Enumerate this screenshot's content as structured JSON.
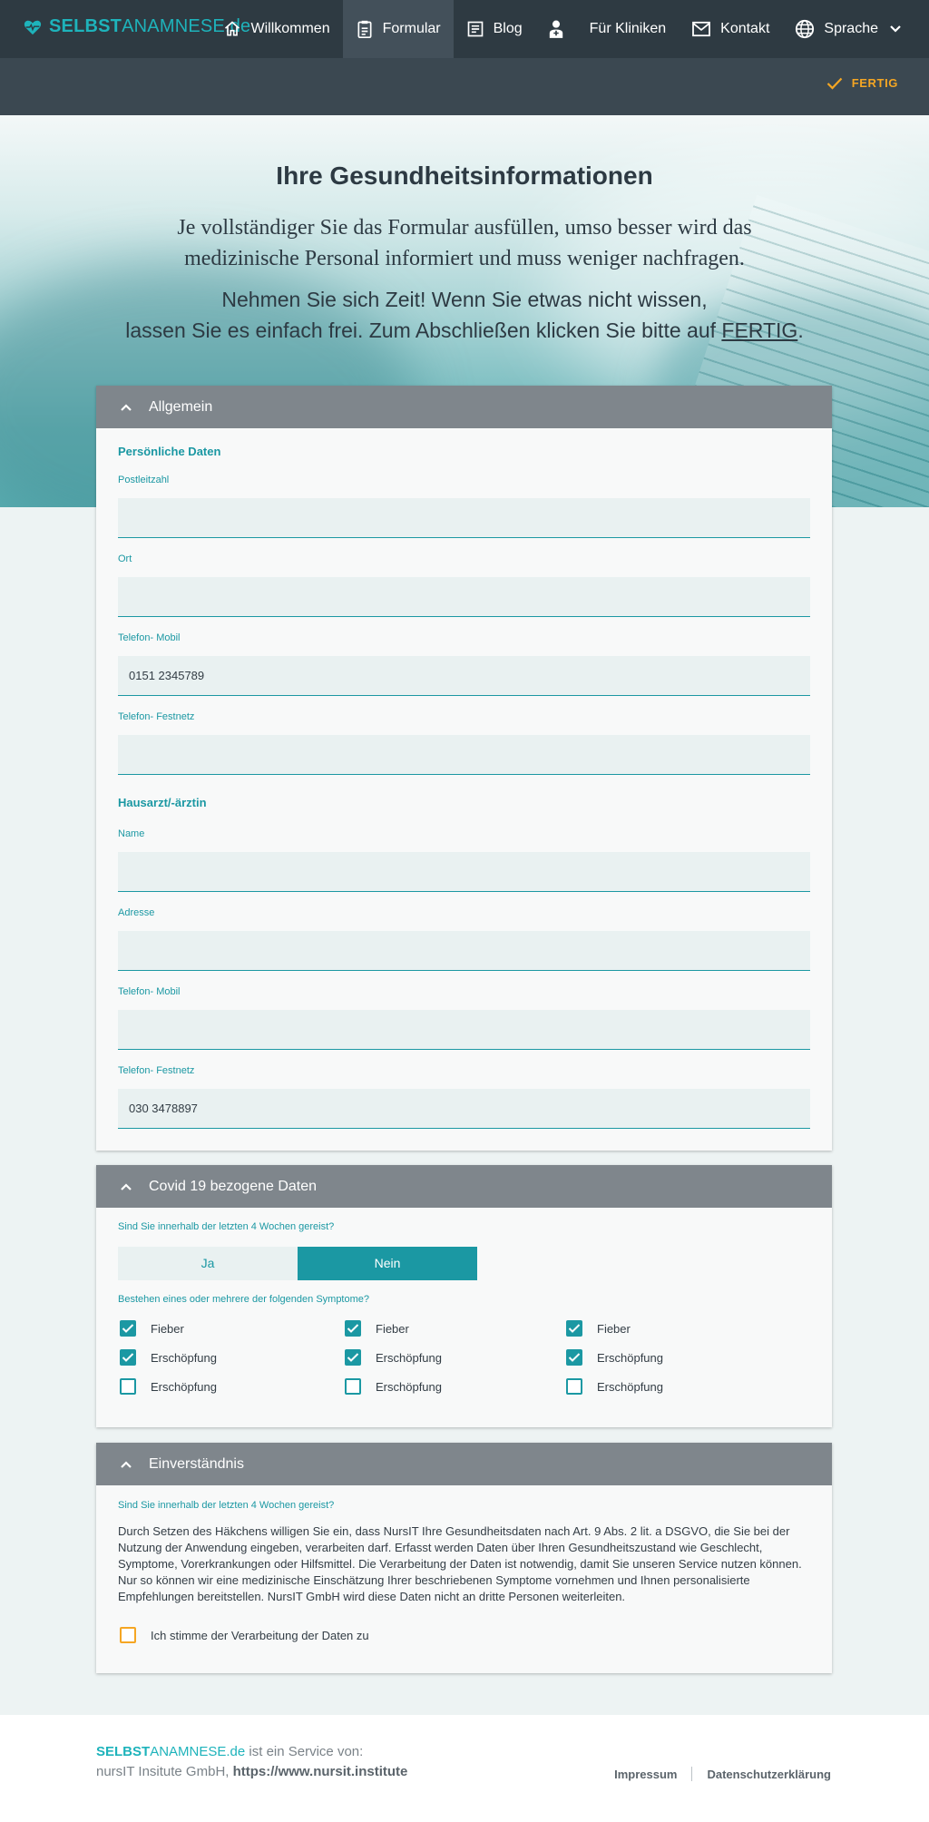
{
  "nav": {
    "logo": {
      "part1": "SELBST",
      "part2": "ANAMNESE",
      "part3": ".de"
    },
    "items": [
      {
        "label": "Willkommen",
        "icon": "home-icon"
      },
      {
        "label": "Formular",
        "icon": "clipboard-icon"
      },
      {
        "label": "Blog",
        "icon": "article-icon"
      },
      {
        "label": "Für Kliniken",
        "icon": "doctor-icon"
      },
      {
        "label": "Kontakt",
        "icon": "mail-icon"
      },
      {
        "label": "Sprache",
        "icon": "globe-icon"
      }
    ],
    "fertig_label": "FERTIG"
  },
  "hero": {
    "title": "Ihre Gesundheitsinformationen",
    "lead": "Je vollständiger Sie das Formular ausfüllen, umso besser wird das medizinische Personal informiert und muss weniger nachfragen.",
    "sub_line1": "Nehmen Sie sich Zeit! Wenn Sie etwas nicht wissen,",
    "sub_line2": "lassen Sie es einfach frei. Zum Abschließen klicken Sie bitte auf",
    "sub_link": "FERTIG",
    "sub_end": "."
  },
  "allgemein": {
    "heading": "Allgemein",
    "personal_title": "Persönliche Daten",
    "plz_label": "Postleitzahl",
    "plz_value": "",
    "ort_label": "Ort",
    "ort_value": "",
    "mobil_label": "Telefon- Mobil",
    "mobil_value": "0151 2345789",
    "fest_label": "Telefon- Festnetz",
    "fest_value": "",
    "doctor_title": "Hausarzt/-ärztin",
    "d_name_label": "Name",
    "d_name_value": "",
    "d_addr_label": "Adresse",
    "d_addr_value": "",
    "d_mobil_label": "Telefon- Mobil",
    "d_mobil_value": "",
    "d_fest_label": "Telefon- Festnetz",
    "d_fest_value": "030 3478897"
  },
  "covid": {
    "heading": "Covid 19 bezogene Daten",
    "q1": "Sind Sie innerhalb der letzten 4 Wochen gereist?",
    "yes": "Ja",
    "no": "Nein",
    "selected": "Nein",
    "q2": "Bestehen eines oder mehrere der folgenden Symptome?",
    "symptoms": [
      [
        {
          "label": "Fieber",
          "checked": true
        },
        {
          "label": "Fieber",
          "checked": true
        },
        {
          "label": "Fieber",
          "checked": true
        }
      ],
      [
        {
          "label": "Erschöpfung",
          "checked": true
        },
        {
          "label": "Erschöpfung",
          "checked": true
        },
        {
          "label": "Erschöpfung",
          "checked": true
        }
      ],
      [
        {
          "label": "Erschöpfung",
          "checked": false
        },
        {
          "label": "Erschöpfung",
          "checked": false
        },
        {
          "label": "Erschöpfung",
          "checked": false
        }
      ]
    ]
  },
  "consent": {
    "heading": "Einverständnis",
    "q": "Sind Sie innerhalb der letzten 4 Wochen gereist?",
    "text": "Durch Setzen des Häkchens willigen Sie ein, dass NursIT Ihre Gesundheitsdaten nach Art. 9 Abs. 2 lit. a DSGVO, die Sie bei der Nutzung der Anwendung eingeben, verarbeiten darf. Erfasst werden Daten über Ihren Gesundheitszustand wie Geschlecht, Symptome, Vorerkrankungen oder Hilfsmittel. Die Verarbeitung der Daten ist notwendig, damit Sie unseren Service nutzen können. Nur so können wir eine medizinische Einschätzung Ihrer beschriebenen Symptome vornehmen und Ihnen personalisierte Empfehlungen bereitstellen. NursIT GmbH wird diese Daten nicht an dritte Personen weiterleiten.",
    "checkbox_label": "Ich stimme der Verarbeitung der Daten zu",
    "checked": false
  },
  "footer": {
    "brand1": "SELBST",
    "brand2": "ANAMNESE",
    "brand3": ".de",
    "service_text": " ist ein Service von:",
    "company": "nursIT Insitute GmbH, ",
    "url": "https://www.nursit.institute",
    "impressum": "Impressum",
    "datenschutz": "Datenschutzerklärung"
  },
  "colors": {
    "accent": "#1b98a3",
    "nav_bg": "#2e3a42",
    "fertig": "#f5a623",
    "card_head": "#7f868c"
  }
}
